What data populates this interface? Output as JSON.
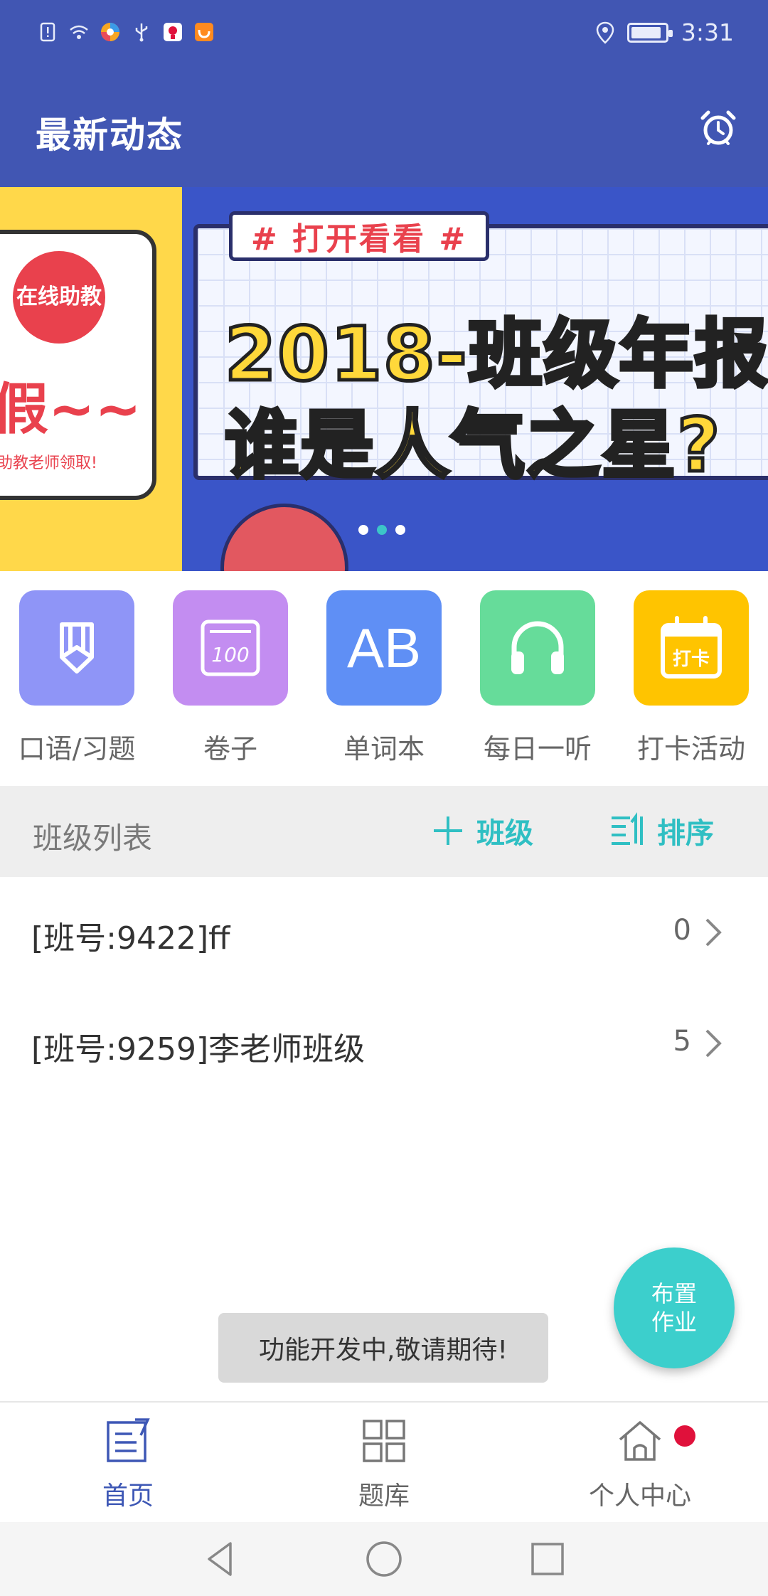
{
  "status_bar": {
    "time": "3:31",
    "battery_level": 0.9,
    "left_icons": [
      "alert-icon",
      "wifi-icon",
      "browser-app-icon",
      "usb-icon",
      "app-notification-icon",
      "uc-browser-icon"
    ],
    "right_icons": [
      "location-icon",
      "battery-icon"
    ]
  },
  "header": {
    "title": "最新动态",
    "alarm_icon": "alarm-clock-icon"
  },
  "banner": {
    "left_slide": {
      "bubble": "在线助教",
      "big_text": "假~~",
      "small_text": "助教老师领取!"
    },
    "main_slide": {
      "tag": "# 打开看看 #",
      "line1": "2018-班级年报",
      "line2": "谁是人气之星?"
    },
    "page_count": 3,
    "active_page": 2
  },
  "actions": [
    {
      "label": "口语/习题",
      "icon": "pencil-icon",
      "color": "#8f95f7"
    },
    {
      "label": "卷子",
      "icon": "test-paper-icon",
      "color": "#c38df1"
    },
    {
      "label": "单词本",
      "icon": "ab-letters-icon",
      "color": "#5f8ff5"
    },
    {
      "label": "每日一听",
      "icon": "headphones-icon",
      "color": "#66dc9a"
    },
    {
      "label": "打卡活动",
      "icon": "calendar-checkin-icon",
      "color": "#ffc400"
    }
  ],
  "class_list": {
    "title": "班级列表",
    "add_label": "班级",
    "sort_label": "排序",
    "accent": "#2fbfc3",
    "rows": [
      {
        "name": "[班号:9422]ff",
        "count": "0"
      },
      {
        "name": "[班号:9259]李老师班级",
        "count": "5"
      }
    ]
  },
  "toast": {
    "text": "功能开发中,敬请期待!"
  },
  "fab": {
    "line1": "布置",
    "line2": "作业"
  },
  "bottom_nav": {
    "items": [
      {
        "label": "首页",
        "icon": "home-notes-icon",
        "active": true
      },
      {
        "label": "题库",
        "icon": "grid-icon",
        "active": false
      },
      {
        "label": "个人中心",
        "icon": "house-icon",
        "active": false,
        "badge": true
      }
    ],
    "active_color": "#3d57b5"
  },
  "system_nav": [
    "back-icon",
    "home-circle-icon",
    "recents-icon"
  ]
}
